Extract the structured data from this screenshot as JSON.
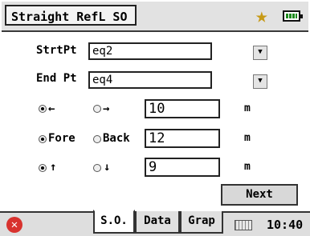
{
  "window": {
    "title": "Straight RefL SO"
  },
  "form": {
    "start": {
      "label": "StrtPt",
      "value": "eq2"
    },
    "end": {
      "label": "End Pt",
      "value": "eq4"
    },
    "row1": {
      "opt1_label": "←",
      "opt2_label": "→",
      "value": "10",
      "unit": "m"
    },
    "row2": {
      "opt1_label": "Fore",
      "opt2_label": "Back",
      "value": "12",
      "unit": "m"
    },
    "row3": {
      "opt1_label": "↑",
      "opt2_label": "↓",
      "value": "9",
      "unit": "m"
    },
    "dropdown_icon": "▼"
  },
  "actions": {
    "next_label": "Next"
  },
  "tabs": [
    {
      "label": "S.O."
    },
    {
      "label": "Data"
    },
    {
      "label": "Grap"
    }
  ],
  "status": {
    "time": "10:40"
  },
  "icons": {
    "close": "✕",
    "star": "★"
  },
  "colors": {
    "star": "#c79a16",
    "close": "#d8322e",
    "battery": "#1d8a1d"
  }
}
